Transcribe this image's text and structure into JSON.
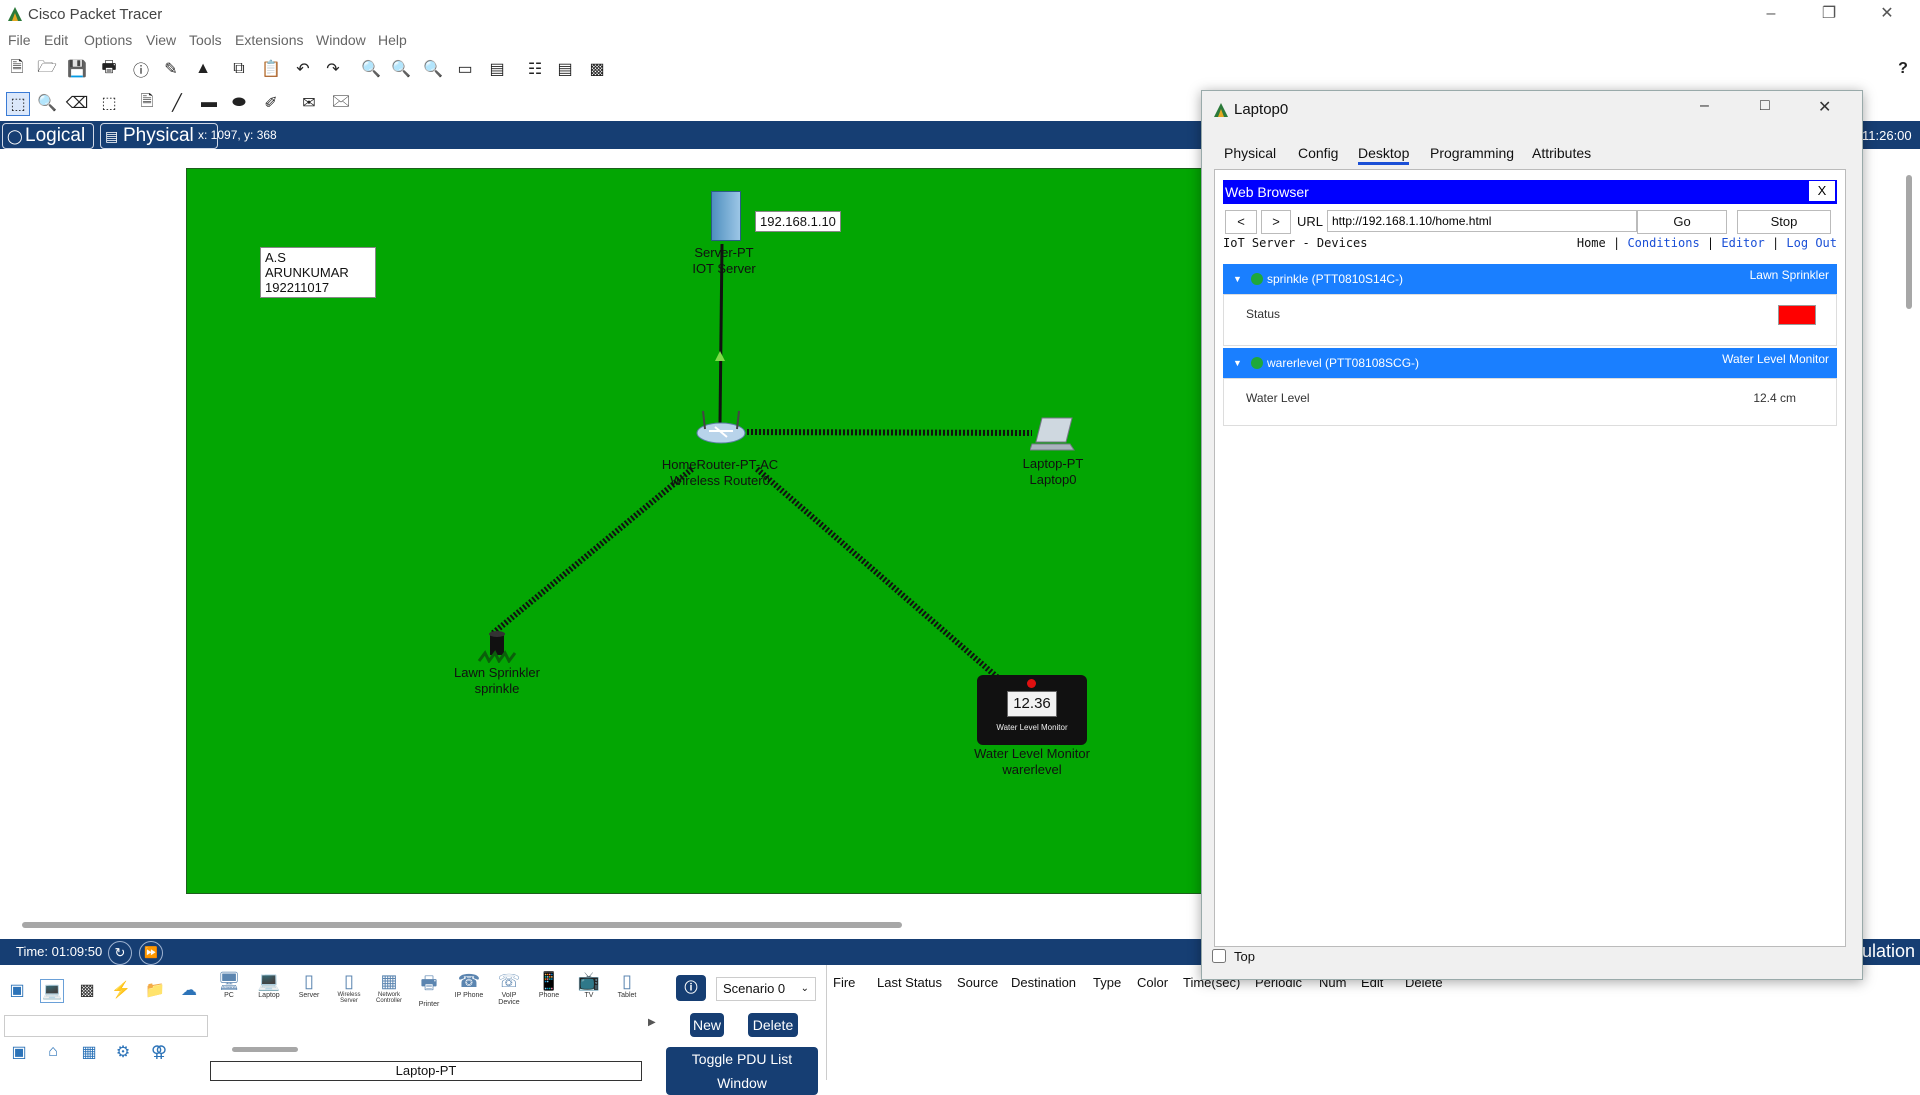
{
  "app": {
    "title": "Cisco Packet Tracer"
  },
  "menu": [
    "File",
    "Edit",
    "Options",
    "View",
    "Tools",
    "Extensions",
    "Window",
    "Help"
  ],
  "help_glyph": "?",
  "view_tabs": {
    "logical": "Logical",
    "physical": "Physical"
  },
  "coords": "x: 1097, y: 368",
  "clock": "11:26:00",
  "canvas": {
    "note": {
      "line1": "A.S ARUNKUMAR",
      "line2": "192211017"
    },
    "server_ip": "192.168.1.10",
    "devices": {
      "server": {
        "model": "Server-PT",
        "name": "IOT Server"
      },
      "router": {
        "model": "HomeRouter-PT-AC",
        "name": "Wireless Router0"
      },
      "laptop": {
        "model": "Laptop-PT",
        "name": "Laptop0"
      },
      "sprinkler": {
        "model": "Lawn Sprinkler",
        "name": "sprinkle"
      },
      "water": {
        "model": "Water Level Monitor",
        "name": "warerlevel",
        "display": "12.36",
        "caption": "Water Level Monitor"
      }
    }
  },
  "timebar": {
    "time": "Time: 01:09:50",
    "right_text": "ulation"
  },
  "bottom": {
    "device_types": [
      "PC",
      "Laptop",
      "Server",
      "Wireless Server",
      "Network Controller",
      "Printer",
      "IP Phone",
      "VoIP Device",
      "Phone",
      "TV",
      "Tablet"
    ],
    "selected_type": "Laptop-PT",
    "scenario": "Scenario 0",
    "new_label": "New",
    "delete_label": "Delete",
    "toggle_label": "Toggle PDU List Window",
    "pdu_columns": [
      "Fire",
      "Last Status",
      "Source",
      "Destination",
      "Type",
      "Color",
      "Time(sec)",
      "Periodic",
      "Num",
      "Edit",
      "Delete"
    ]
  },
  "laptop_window": {
    "title": "Laptop0",
    "tabs": [
      "Physical",
      "Config",
      "Desktop",
      "Programming",
      "Attributes"
    ],
    "active_tab": "Desktop",
    "browser": {
      "header": "Web Browser",
      "close": "X",
      "back": "<",
      "forward": ">",
      "url_label": "URL",
      "url": "http://192.168.1.10/home.html",
      "go": "Go",
      "stop": "Stop",
      "page_title": "IoT Server - Devices",
      "nav": [
        "Home",
        "Conditions",
        "Editor",
        "Log Out"
      ],
      "devices": [
        {
          "name": "sprinkle (PTT0810S14C-)",
          "type": "Lawn Sprinkler",
          "field": "Status",
          "value": "",
          "status_color": "#ff0000"
        },
        {
          "name": "warerlevel (PTT08108SCG-)",
          "type": "Water Level Monitor",
          "field": "Water Level",
          "value": "12.4 cm"
        }
      ]
    },
    "top_checkbox": "Top"
  },
  "colors": {
    "canvas_green": "#03a603",
    "bar_blue": "#163e73",
    "browser_blue": "#0000ff",
    "device_row": "#1a7fff"
  }
}
